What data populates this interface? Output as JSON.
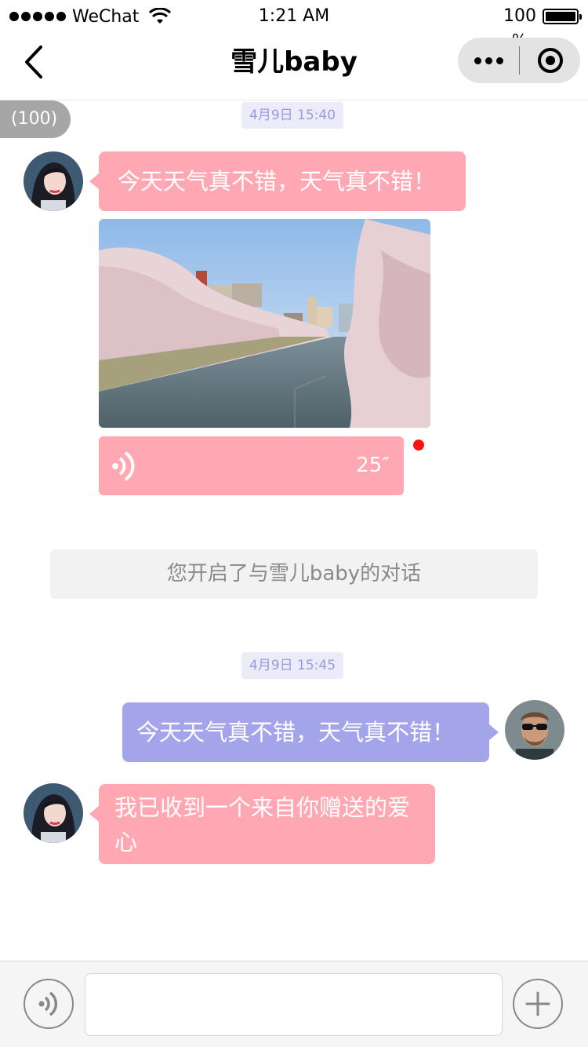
{
  "status_bar": {
    "carrier": "WeChat",
    "time": "1:21 AM",
    "battery_value": "100",
    "battery_unit": "%",
    "battery_level": 1.0
  },
  "nav": {
    "title": "雪儿baby"
  },
  "count_tag": "(100)",
  "timestamps": [
    "4月9日 15:40",
    "4月9日 15:45"
  ],
  "messages": {
    "m1_text": "今天天气真不错，天气真不错！",
    "voice_duration": "25″",
    "system_notice": "您开启了与雪儿baby的对话",
    "m3_text": "今天天气真不错，天气真不错！",
    "m4_text": "我已收到一个来自你赠送的爱心"
  },
  "input": {
    "placeholder": ""
  },
  "colors": {
    "pink_bubble": "#ffa8b3",
    "purple_bubble": "#a4a4ea",
    "timestamp_bg": "#ececf8",
    "timestamp_text": "#9a9ae0",
    "unread_dot": "#ff1111"
  }
}
